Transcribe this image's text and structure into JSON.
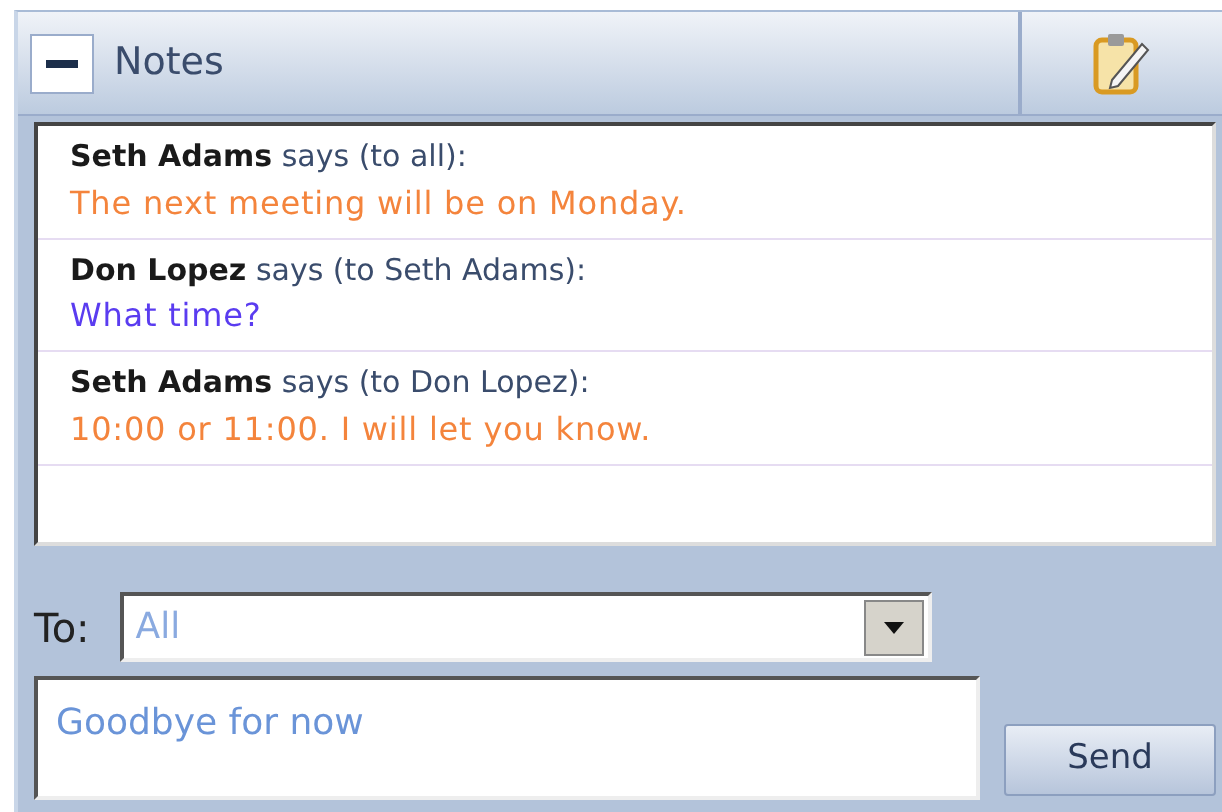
{
  "panel": {
    "title": "Notes",
    "expanded": true
  },
  "messages": [
    {
      "header": "**Seth Adams** says (to all):",
      "text": "The next meeting will be on Monday.",
      "color": "#f4843c"
    },
    {
      "header": "**Don Lopez** says (to Seth Adams):",
      "text": "What time?",
      "color": "#5a3cf0"
    },
    {
      "header": "**Seth Adams** says (to Don Lopez):",
      "text": "10:00 or 11:00. I will let you know.",
      "color": "#f4843c"
    }
  ],
  "to": {
    "label": "To:",
    "value": "All"
  },
  "message_box": {
    "value": "Goodbye for now"
  },
  "send_button": "Send"
}
